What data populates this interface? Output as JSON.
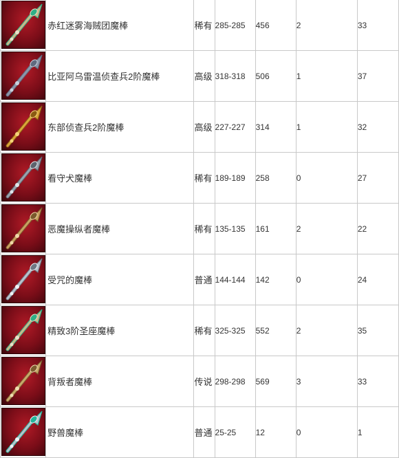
{
  "rows": [
    {
      "icon": "green-gem-spear-wand-icon",
      "name": "赤红迷雾海贼团魔棒",
      "rarity": "稀有",
      "damage": "285-285",
      "value": "456",
      "slot": "2",
      "level": "33"
    },
    {
      "icon": "stone-lion-wand-icon",
      "name": "比亚阿乌雷温侦查兵2阶魔棒",
      "rarity": "高级",
      "damage": "318-318",
      "value": "506",
      "slot": "1",
      "level": "37"
    },
    {
      "icon": "golden-lion-wand-icon",
      "name": "东部侦查兵2阶魔棒",
      "rarity": "高级",
      "damage": "227-227",
      "value": "314",
      "slot": "1",
      "level": "32"
    },
    {
      "icon": "compass-orb-wand-icon",
      "name": "看守犬魔棒",
      "rarity": "稀有",
      "damage": "189-189",
      "value": "258",
      "slot": "0",
      "level": "27"
    },
    {
      "icon": "bronze-scepter-wand-icon",
      "name": "恶魔操纵者魔棒",
      "rarity": "稀有",
      "damage": "135-135",
      "value": "161",
      "slot": "2",
      "level": "22"
    },
    {
      "icon": "silver-trident-wand-icon",
      "name": "受咒的魔棒",
      "rarity": "普通",
      "damage": "144-144",
      "value": "142",
      "slot": "0",
      "level": "24"
    },
    {
      "icon": "ornate-spear-wand-icon",
      "name": "精致3阶圣座魔棒",
      "rarity": "稀有",
      "damage": "325-325",
      "value": "552",
      "slot": "2",
      "level": "35"
    },
    {
      "icon": "leaf-blade-wand-icon",
      "name": "背叛者魔棒",
      "rarity": "传说",
      "damage": "298-298",
      "value": "569",
      "slot": "3",
      "level": "33"
    },
    {
      "icon": "green-crystal-blade-wand-icon",
      "name": "野兽魔棒",
      "rarity": "普通",
      "damage": "25-25",
      "value": "12",
      "slot": "0",
      "level": "1"
    }
  ]
}
